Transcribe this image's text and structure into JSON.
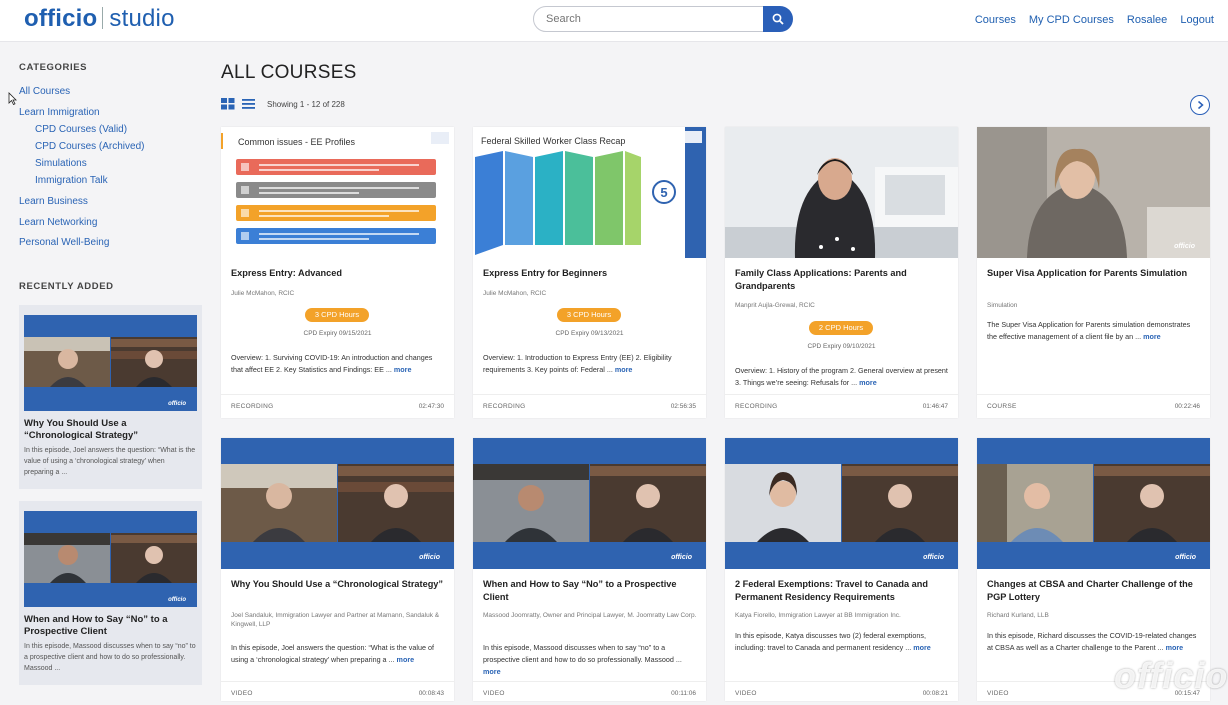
{
  "header": {
    "logo_brand": "officio",
    "logo_product": "studio",
    "search_placeholder": "Search",
    "nav": [
      "Courses",
      "My CPD Courses",
      "Rosalee",
      "Logout"
    ]
  },
  "sidebar": {
    "categories_heading": "CATEGORIES",
    "categories": [
      {
        "label": "All Courses",
        "level": 0
      },
      {
        "label": "Learn Immigration",
        "level": 0
      },
      {
        "label": "CPD Courses (Valid)",
        "level": 1
      },
      {
        "label": "CPD Courses (Archived)",
        "level": 1
      },
      {
        "label": "Simulations",
        "level": 1
      },
      {
        "label": "Immigration Talk",
        "level": 1
      },
      {
        "label": "Learn Business",
        "level": 0
      },
      {
        "label": "Learn Networking",
        "level": 0
      },
      {
        "label": "Personal Well-Being",
        "level": 0
      }
    ],
    "recent_heading": "RECENTLY ADDED",
    "recent": [
      {
        "title": "Why You Should Use a “Chronological Strategy”",
        "desc": "In this episode, Joel answers the question: “What is the value of using a ‘chronological strategy’ when preparing a ..."
      },
      {
        "title": "When and How to Say “No” to a Prospective Client",
        "desc": "In this episode, Massood discusses when to say “no” to a prospective client and how to do so professionally. Massood ..."
      }
    ]
  },
  "main": {
    "title": "ALL COURSES",
    "showing": "Showing 1 - 12 of 228",
    "more_label": "more",
    "cards": [
      {
        "title": "Express Entry: Advanced",
        "author": "Julie McMahon, RCIC",
        "cpd": "3 CPD Hours",
        "expiry": "CPD Expiry 09/15/2021",
        "overview": "Overview: 1. Surviving COVID-19: An introduction and changes that affect EE 2. Key Statistics and Findings: EE ...",
        "type": "RECORDING",
        "duration": "02:47:30",
        "slide_title": "Common issues - EE Profiles"
      },
      {
        "title": "Express Entry for Beginners",
        "author": "Julie McMahon, RCIC",
        "cpd": "3 CPD Hours",
        "expiry": "CPD Expiry 09/13/2021",
        "overview": "Overview: 1. Introduction to Express Entry (EE) 2. Eligibility requirements 3. Key points of: Federal ...",
        "type": "RECORDING",
        "duration": "02:56:35",
        "slide_title": "Federal Skilled Worker Class Recap",
        "slide_badge": "5"
      },
      {
        "title": "Family Class Applications: Parents and Grandparents",
        "author": "Manprit Aujla-Grewal, RCIC",
        "cpd": "2 CPD Hours",
        "expiry": "CPD Expiry 09/10/2021",
        "overview": "Overview: 1. History of the program 2. General overview at present 3. Things we’re seeing: Refusals for ...",
        "type": "RECORDING",
        "duration": "01:46:47"
      },
      {
        "title": "Super Visa Application for Parents Simulation",
        "author": "Simulation",
        "overview": "The Super Visa Application for Parents simulation demonstrates the effective management of a client file by an ...",
        "type": "COURSE",
        "duration": "00:22:46"
      },
      {
        "title": "Why You Should Use a “Chronological Strategy”",
        "author": "Joel Sandaluk, Immigration Lawyer and Partner at Mamann, Sandaluk & Kingwell, LLP",
        "overview": "In this episode, Joel answers the question: “What is the value of using a ‘chronological strategy’ when preparing a ...",
        "type": "VIDEO",
        "duration": "00:08:43"
      },
      {
        "title": "When and How to Say “No” to a Prospective Client",
        "author": "Massood Joomratty, Owner and Principal Lawyer, M. Joomratty Law Corp.",
        "overview": "In this episode, Massood discusses when to say “no” to a prospective client and how to do so professionally. Massood ...",
        "type": "VIDEO",
        "duration": "00:11:06"
      },
      {
        "title": "2 Federal Exemptions: Travel to Canada and Permanent Residency Requirements",
        "author": "Katya Fiorello, Immigration Lawyer at BB Immigration Inc.",
        "overview": "In this episode, Katya discusses two (2) federal exemptions, including: travel to Canada and permanent residency ...",
        "type": "VIDEO",
        "duration": "00:08:21"
      },
      {
        "title": "Changes at CBSA and Charter Challenge of the PGP Lottery",
        "author": "Richard Kurland, LLB",
        "overview": "In this episode, Richard discusses the COVID-19-related changes at CBSA as well as a Charter challenge to the Parent ...",
        "type": "VIDEO",
        "duration": "00:15:47"
      }
    ]
  },
  "video_brand": "officio",
  "watermark": "officio",
  "colors": {
    "brand": "#1f5fb0",
    "accent": "#2a5fb8",
    "cpd_pill": "#f3a229",
    "video_band": "#2f63b0"
  },
  "icons": [
    "search-icon",
    "grid-view-icon",
    "list-view-icon",
    "chevron-right-icon",
    "cursor-icon"
  ]
}
